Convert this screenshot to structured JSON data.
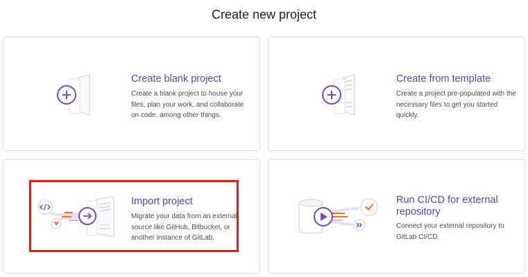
{
  "page": {
    "title": "Create new project"
  },
  "cards": [
    {
      "title": "Create blank project",
      "description": "Create a blank project to house your files, plan your work, and collaborate on code, among other things."
    },
    {
      "title": "Create from template",
      "description": "Create a project pre-populated with the necessary files to get you started quickly."
    },
    {
      "title": "Import project",
      "description": "Migrate your data from an external source like GitHub, Bitbucket, or another instance of GitLab."
    },
    {
      "title": "Run CI/CD for external repository",
      "description": "Connect your external repository to GitLab CI/CD."
    }
  ],
  "colors": {
    "accent": "#5943b6",
    "highlight": "#e3191b",
    "orange": "#fc6d26"
  },
  "icons": {
    "blank": "plus-icon",
    "template": "plus-icon",
    "import": "arrow-right-icon",
    "code": "code-icon",
    "gitlab_badge": "gitlab-icon",
    "cicd_play": "play-icon",
    "cicd_check": "check-icon",
    "cicd_next": "double-chevron-icon"
  }
}
